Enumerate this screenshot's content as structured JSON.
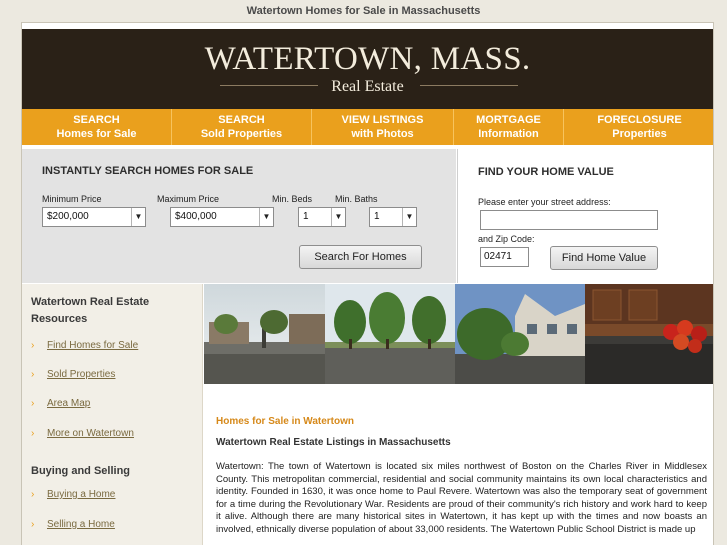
{
  "page": {
    "title": "Watertown Homes for Sale in Massachusetts"
  },
  "banner": {
    "title": "WATERTOWN, MASS.",
    "subtitle": "Real Estate"
  },
  "nav": [
    {
      "line1": "SEARCH",
      "line2": "Homes for Sale"
    },
    {
      "line1": "SEARCH",
      "line2": "Sold Properties"
    },
    {
      "line1": "VIEW LISTINGS",
      "line2": "with Photos"
    },
    {
      "line1": "MORTGAGE",
      "line2": "Information"
    },
    {
      "line1": "FORECLOSURE",
      "line2": "Properties"
    }
  ],
  "search": {
    "heading": "INSTANTLY SEARCH HOMES FOR SALE",
    "min_price_label": "Minimum Price",
    "min_price_value": "$200,000",
    "max_price_label": "Maximum Price",
    "max_price_value": "$400,000",
    "beds_label": "Min. Beds",
    "beds_value": "1",
    "baths_label": "Min. Baths",
    "baths_value": "1",
    "button": "Search For Homes"
  },
  "home_value": {
    "heading": "FIND YOUR HOME VALUE",
    "address_label": "Please enter your street address:",
    "address_value": "",
    "zip_label": "and Zip Code:",
    "zip_value": "02471",
    "button": "Find Home Value"
  },
  "sidebar": {
    "section1_title": "Watertown Real Estate Resources",
    "section1_links": [
      "Find Homes for Sale",
      "Sold Properties",
      "Area Map",
      "More on Watertown"
    ],
    "section2_title": "Buying and Selling",
    "section2_links": [
      "Buying a Home",
      "Selling a Home"
    ]
  },
  "content": {
    "heading": "Homes for Sale in Watertown",
    "subheading": "Watertown Real Estate Listings in Massachusetts",
    "body": "Watertown: The town of Watertown is located six miles northwest of Boston on the Charles River in Middlesex County. This metropolitan commercial, residential and social community maintains its own local characteristics and identity. Founded in 1630, it was once home to Paul Revere. Watertown was also the temporary seat of government for a time during the Revolutionary War. Residents are proud of their community's rich history and work hard to keep it alive. Although there are many historical sites in Watertown, it has kept up with the times and now boasts an involved, ethnically diverse population of about 33,000 residents. The Watertown Public School District is made up"
  },
  "colors": {
    "banner_bg": "#2a2117",
    "nav_bg": "#eaa01d",
    "accent_heading": "#d6891a",
    "link": "#7a6a40"
  }
}
